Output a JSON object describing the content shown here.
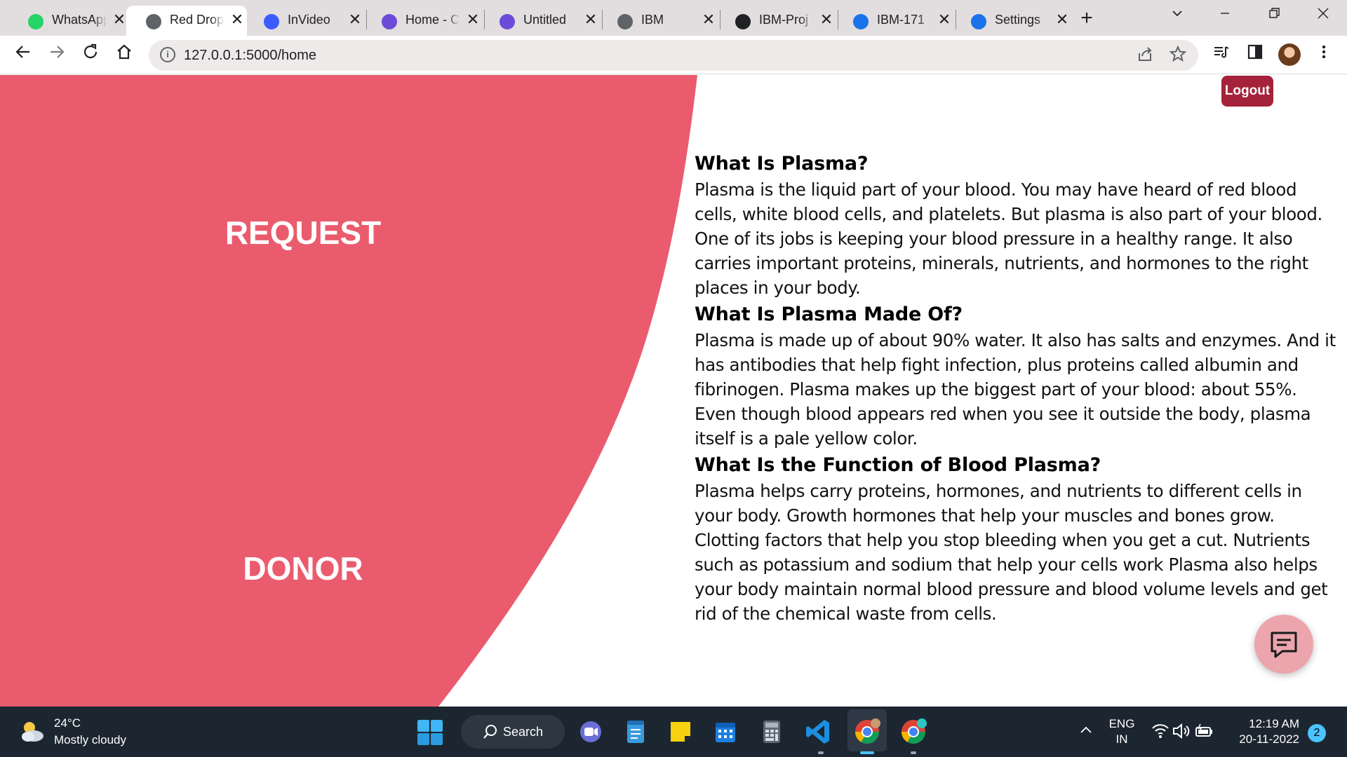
{
  "browser": {
    "tabs": [
      {
        "label": "WhatsApp",
        "icon": "whatsapp-icon",
        "color": "#25d366",
        "active": false
      },
      {
        "label": "Red Drop",
        "icon": "globe-icon",
        "color": "#5f6368",
        "active": true
      },
      {
        "label": "InVideo",
        "icon": "invideo-icon",
        "color": "#3d5afe",
        "active": false
      },
      {
        "label": "Home - C",
        "icon": "canva-icon",
        "color": "#6c4bd8",
        "active": false
      },
      {
        "label": "Untitled",
        "icon": "canva-icon",
        "color": "#6c4bd8",
        "active": false
      },
      {
        "label": "IBM",
        "icon": "globe-icon",
        "color": "#5f6368",
        "active": false
      },
      {
        "label": "IBM-Proj",
        "icon": "github-icon",
        "color": "#202124",
        "active": false
      },
      {
        "label": "IBM-171",
        "icon": "document-icon",
        "color": "#1a73e8",
        "active": false
      },
      {
        "label": "Settings",
        "icon": "gear-icon",
        "color": "#1a73e8",
        "active": false
      }
    ],
    "url": "127.0.0.1:5000/home"
  },
  "page": {
    "request_label": "REQUEST",
    "donor_label": "DONOR",
    "logout_label": "Logout",
    "accent_color": "#ea5b6e",
    "logout_color": "#a4223a",
    "sections": [
      {
        "heading": "What Is Plasma?",
        "body": "Plasma is the liquid part of your blood. You may have heard of red blood cells, white blood cells, and platelets. But plasma is also part of your blood. One of its jobs is keeping your blood pressure in a healthy range. It also carries important proteins, minerals, nutrients, and hormones to the right places in your body."
      },
      {
        "heading": "What Is Plasma Made Of?",
        "body": "Plasma is made up of about 90% water. It also has salts and enzymes. And it has antibodies that help fight infection, plus proteins called albumin and fibrinogen. Plasma makes up the biggest part of your blood: about 55%. Even though blood appears red when you see it outside the body, plasma itself is a pale yellow color."
      },
      {
        "heading": "What Is the Function of Blood Plasma?",
        "body": "Plasma helps carry proteins, hormones, and nutrients to different cells in your body. Growth hormones that help your muscles and bones grow. Clotting factors that help you stop bleeding when you get a cut. Nutrients such as potassium and sodium that help your cells work Plasma also helps your body maintain normal blood pressure and blood volume levels and get rid of the chemical waste from cells."
      }
    ]
  },
  "taskbar": {
    "weather_temp": "24°C",
    "weather_desc": "Mostly cloudy",
    "search_label": "Search",
    "lang_line1": "ENG",
    "lang_line2": "IN",
    "time": "12:19 AM",
    "date": "20-11-2022",
    "notifications": "2"
  }
}
